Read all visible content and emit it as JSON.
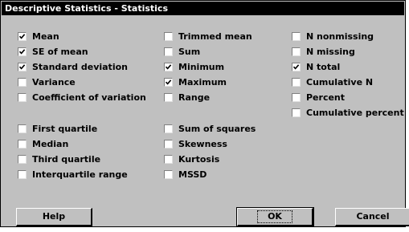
{
  "dialog": {
    "title": "Descriptive Statistics - Statistics"
  },
  "options": [
    {
      "id": "mean",
      "label": "Mean",
      "checked": true
    },
    {
      "id": "se-of-mean",
      "label": "SE of mean",
      "checked": true
    },
    {
      "id": "standard-deviation",
      "label": "Standard deviation",
      "checked": true
    },
    {
      "id": "variance",
      "label": "Variance",
      "checked": false
    },
    {
      "id": "coefficient-of-variation",
      "label": "Coefficient of variation",
      "checked": false
    },
    {
      "id": "first-quartile",
      "label": "First quartile",
      "checked": false
    },
    {
      "id": "median",
      "label": "Median",
      "checked": false
    },
    {
      "id": "third-quartile",
      "label": "Third quartile",
      "checked": false
    },
    {
      "id": "interquartile-range",
      "label": "Interquartile range",
      "checked": false
    },
    {
      "id": "trimmed-mean",
      "label": "Trimmed mean",
      "checked": false
    },
    {
      "id": "sum",
      "label": "Sum",
      "checked": false
    },
    {
      "id": "minimum",
      "label": "Minimum",
      "checked": true
    },
    {
      "id": "maximum",
      "label": "Maximum",
      "checked": true
    },
    {
      "id": "range",
      "label": "Range",
      "checked": false
    },
    {
      "id": "sum-of-squares",
      "label": "Sum of squares",
      "checked": false
    },
    {
      "id": "skewness",
      "label": "Skewness",
      "checked": false
    },
    {
      "id": "kurtosis",
      "label": "Kurtosis",
      "checked": false
    },
    {
      "id": "mssd",
      "label": "MSSD",
      "checked": false
    },
    {
      "id": "n-nonmissing",
      "label": "N nonmissing",
      "checked": false
    },
    {
      "id": "n-missing",
      "label": "N missing",
      "checked": false
    },
    {
      "id": "n-total",
      "label": "N total",
      "checked": true
    },
    {
      "id": "cumulative-n",
      "label": "Cumulative N",
      "checked": false
    },
    {
      "id": "percent",
      "label": "Percent",
      "checked": false
    },
    {
      "id": "cumulative-percent",
      "label": "Cumulative percent",
      "checked": false
    }
  ],
  "buttons": {
    "help": "Help",
    "ok": "OK",
    "cancel": "Cancel"
  }
}
